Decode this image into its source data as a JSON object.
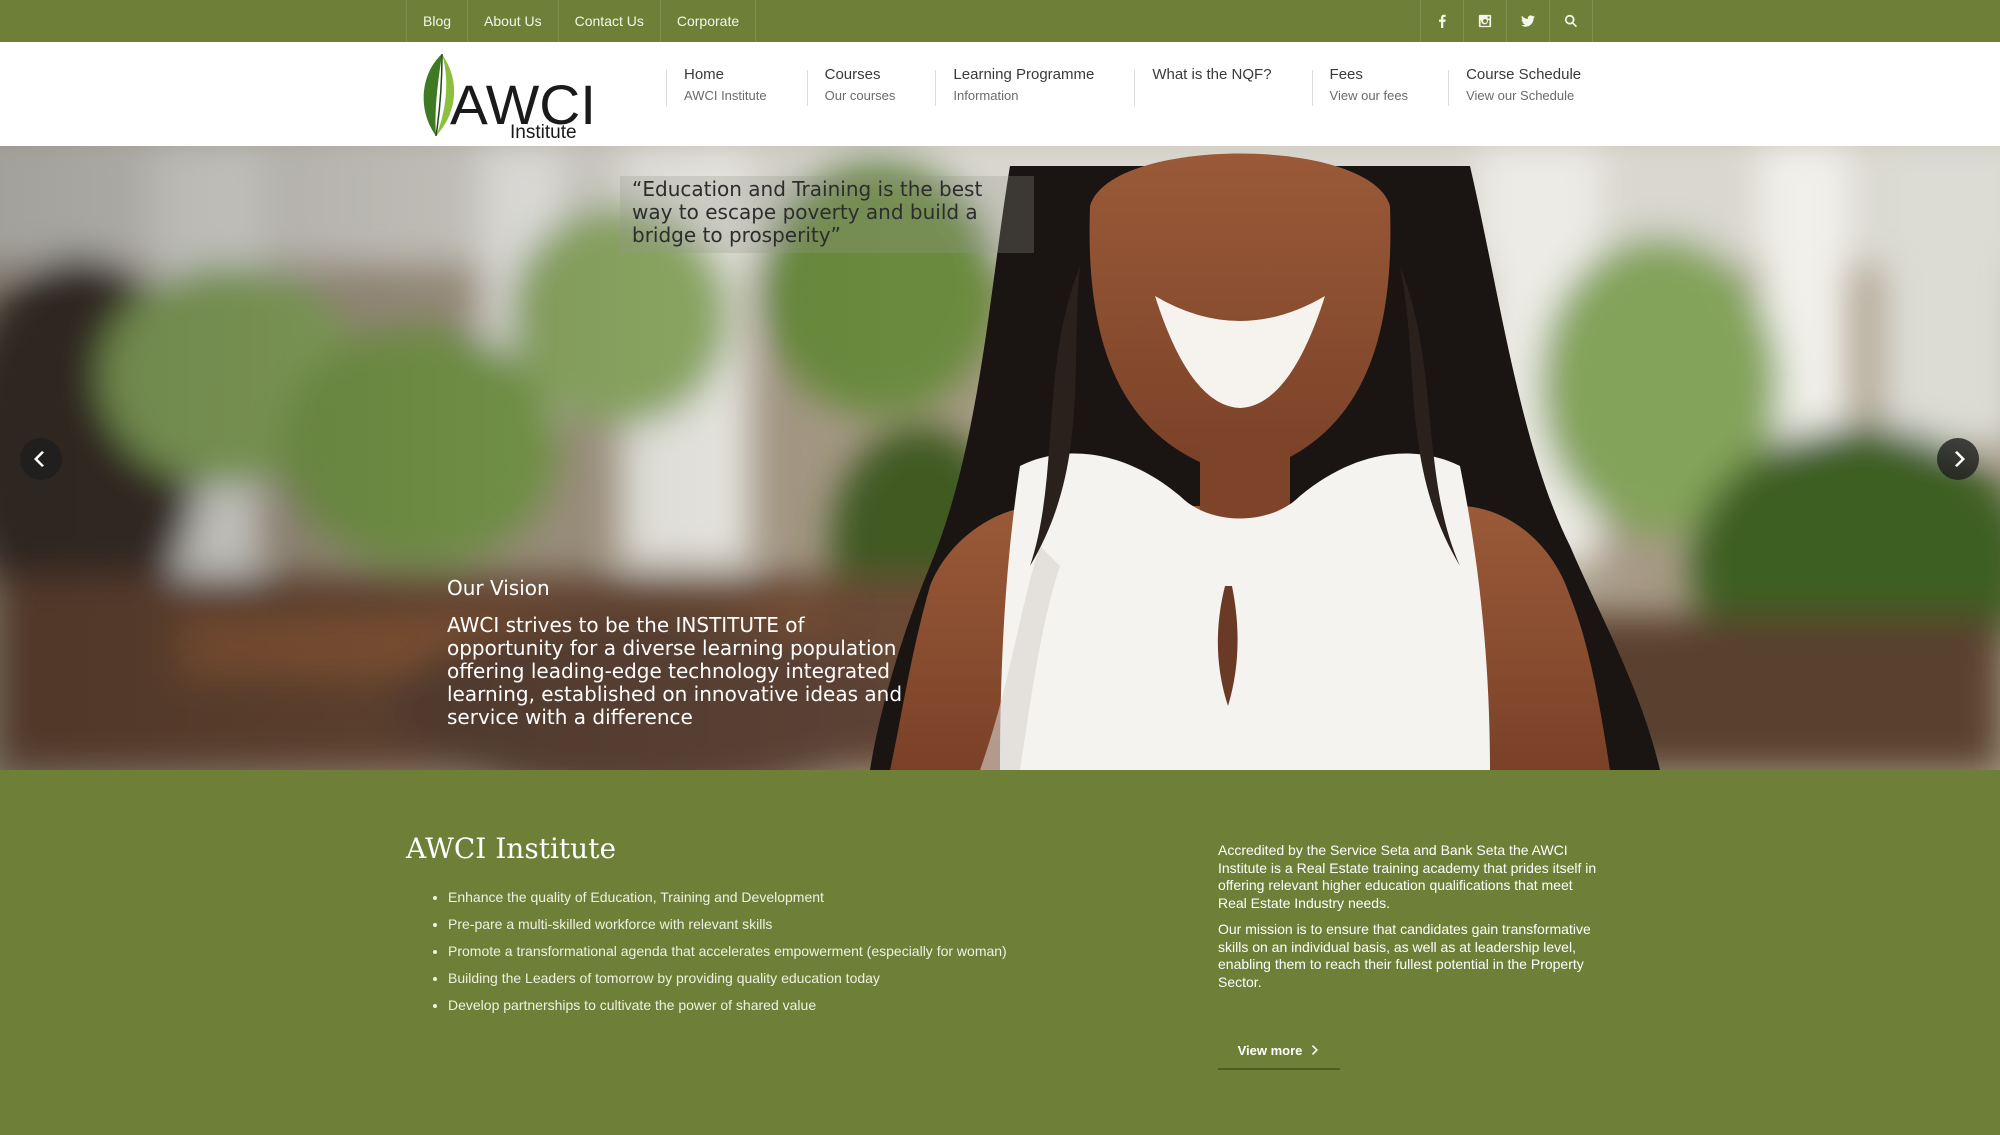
{
  "topbar": {
    "links": [
      "Blog",
      "About Us",
      "Contact Us",
      "Corporate"
    ],
    "icons": [
      "facebook-icon",
      "instagram-icon",
      "twitter-icon",
      "search-icon"
    ]
  },
  "logo": {
    "name": "AWCI",
    "sub": "Institute"
  },
  "nav": [
    {
      "title": "Home",
      "sub": "AWCI Institute"
    },
    {
      "title": "Courses",
      "sub": "Our courses"
    },
    {
      "title": "Learning Programme",
      "sub": "Information"
    },
    {
      "title": "What is the NQF?",
      "sub": ""
    },
    {
      "title": "Fees",
      "sub": "View our fees"
    },
    {
      "title": "Course Schedule",
      "sub": "View our Schedule"
    }
  ],
  "hero": {
    "quote": "“Education and Training is the best way to escape poverty and build a bridge to prosperity”",
    "vision_title": "Our Vision",
    "vision_text": "AWCI strives to be the INSTITUTE of opportunity for a diverse learning population offering leading-edge technology integrated learning, established on innovative ideas and service with a difference"
  },
  "content": {
    "title": "AWCI Institute",
    "bullets": [
      "Enhance the quality of Education, Training and Development",
      "Pre-pare a multi-skilled workforce with relevant skills",
      "Promote a transformational agenda that accelerates empowerment (especially for woman)",
      "Building the Leaders of tomorrow by providing quality education today",
      "Develop partnerships to cultivate the power of shared value"
    ],
    "paragraph1": "Accredited by the Service Seta and Bank Seta the AWCI Institute is a Real Estate training academy that prides itself in offering relevant higher education qualifications that meet Real Estate Industry needs.",
    "paragraph2": "Our mission is to ensure that candidates gain transformative skills on an individual basis, as well as at leadership level, enabling them to reach their fullest potential in the Property Sector.",
    "view_more": "View more"
  },
  "colors": {
    "brand_green": "#6e7f37",
    "text_dark": "#3a3a3a"
  }
}
